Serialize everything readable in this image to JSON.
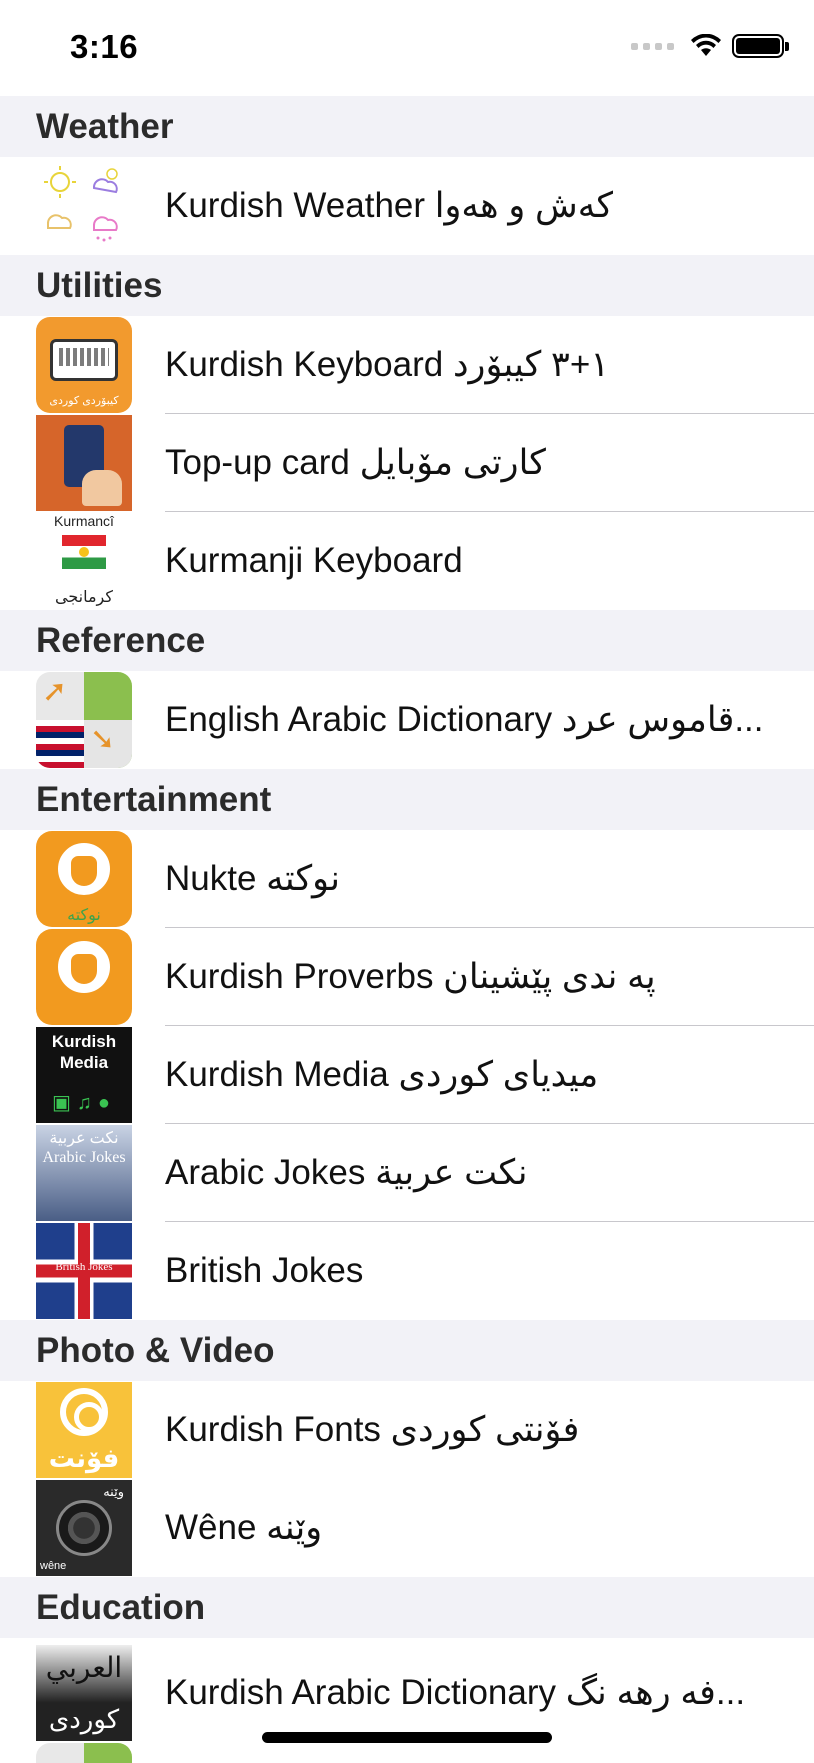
{
  "status_bar": {
    "time": "3:16"
  },
  "sections": [
    {
      "header": "Weather",
      "items": [
        {
          "title": "Kurdish Weather کەش و هەوا",
          "icon": "weather-app-icon"
        }
      ]
    },
    {
      "header": "Utilities",
      "items": [
        {
          "title": "Kurdish Keyboard ١+٣ کیبۆرد",
          "icon": "keyboard-app-icon",
          "icon_text": "کیبۆردی کوردی"
        },
        {
          "title": "Top-up card کارتی مۆبایل",
          "icon": "topup-card-app-icon"
        },
        {
          "title": "Kurmanji Keyboard",
          "icon": "kurmanci-app-icon",
          "icon_text_top": "Kurmancî",
          "icon_text_bottom": "کرمانجی"
        }
      ]
    },
    {
      "header": "Reference",
      "items": [
        {
          "title": "English Arabic Dictionary قاموس عرد...",
          "icon": "dictionary-app-icon"
        }
      ]
    },
    {
      "header": "Entertainment",
      "items": [
        {
          "title": "Nukte نوکتە",
          "icon": "nukte-app-icon",
          "icon_text": "نوکتە"
        },
        {
          "title": "Kurdish Proverbs پە ندی پێشینان",
          "icon": "proverbs-app-icon"
        },
        {
          "title": "Kurdish Media میدیای کوردی",
          "icon": "media-app-icon",
          "icon_text": "Kurdish Media"
        },
        {
          "title": "Arabic Jokes نكت عربية",
          "icon": "arabic-jokes-app-icon",
          "icon_text": "نكت عربية Arabic Jokes"
        },
        {
          "title": "British Jokes",
          "icon": "british-jokes-app-icon",
          "icon_text": "British Jokes"
        }
      ]
    },
    {
      "header": "Photo & Video",
      "items": [
        {
          "title": "Kurdish Fonts فۆنتی کوردی",
          "icon": "fonts-app-icon",
          "icon_text": "فۆنت"
        },
        {
          "title": "Wêne  وێنە",
          "icon": "wene-camera-app-icon",
          "icon_text_top": "وێنە",
          "icon_text_bottom": "wêne"
        }
      ]
    },
    {
      "header": "Education",
      "items": [
        {
          "title": "Kurdish Arabic Dictionary  فە رهە نگ...",
          "icon": "kurdish-arabic-dictionary-app-icon",
          "icon_text_top": "العربي",
          "icon_text_bottom": "کوردی"
        }
      ]
    }
  ]
}
